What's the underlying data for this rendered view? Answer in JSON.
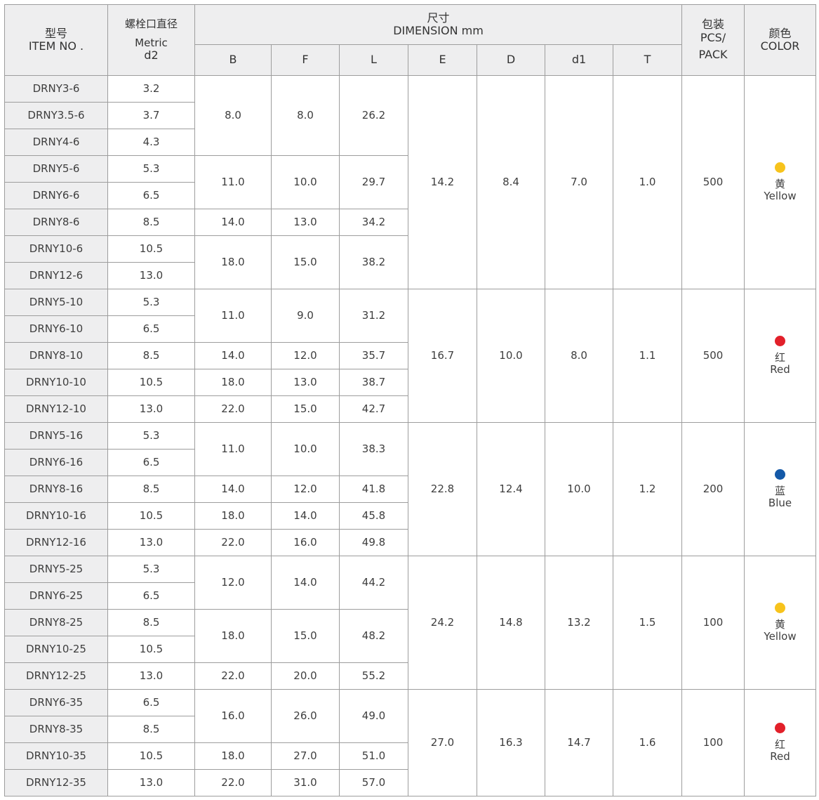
{
  "header": {
    "item_cn": "型号",
    "item_en": "ITEM NO .",
    "bolt_cn": "螺栓口直径",
    "bolt_en": "Metric",
    "bolt_sym": "d2",
    "dim_cn": "尺寸",
    "dim_en": "DIMENSION mm",
    "pack_cn": "包装",
    "pack_en1": "PCS/",
    "pack_en2": "PACK",
    "color_cn": "颜色",
    "color_en": "COLOR",
    "cols": [
      "B",
      "F",
      "L",
      "E",
      "D",
      "d1",
      "T"
    ]
  },
  "rows": [
    [
      "DRNY3-6",
      "3.2"
    ],
    [
      "DRNY3.5-6",
      "3.7"
    ],
    [
      "DRNY4-6",
      "4.3"
    ],
    [
      "DRNY5-6",
      "5.3"
    ],
    [
      "DRNY6-6",
      "6.5"
    ],
    [
      "DRNY8-6",
      "8.5"
    ],
    [
      "DRNY10-6",
      "10.5"
    ],
    [
      "DRNY12-6",
      "13.0"
    ],
    [
      "DRNY5-10",
      "5.3"
    ],
    [
      "DRNY6-10",
      "6.5"
    ],
    [
      "DRNY8-10",
      "8.5"
    ],
    [
      "DRNY10-10",
      "10.5"
    ],
    [
      "DRNY12-10",
      "13.0"
    ],
    [
      "DRNY5-16",
      "5.3"
    ],
    [
      "DRNY6-16",
      "6.5"
    ],
    [
      "DRNY8-16",
      "8.5"
    ],
    [
      "DRNY10-16",
      "10.5"
    ],
    [
      "DRNY12-16",
      "13.0"
    ],
    [
      "DRNY5-25",
      "5.3"
    ],
    [
      "DRNY6-25",
      "6.5"
    ],
    [
      "DRNY8-25",
      "8.5"
    ],
    [
      "DRNY10-25",
      "10.5"
    ],
    [
      "DRNY12-25",
      "13.0"
    ],
    [
      "DRNY6-35",
      "6.5"
    ],
    [
      "DRNY8-35",
      "8.5"
    ],
    [
      "DRNY10-35",
      "10.5"
    ],
    [
      "DRNY12-35",
      "13.0"
    ]
  ],
  "bfl": [
    [
      "8.0",
      "8.0",
      "26.2"
    ],
    [
      "11.0",
      "10.0",
      "29.7"
    ],
    [
      "14.0",
      "13.0",
      "34.2"
    ],
    [
      "18.0",
      "15.0",
      "38.2"
    ],
    [
      "11.0",
      "9.0",
      "31.2"
    ],
    [
      "14.0",
      "12.0",
      "35.7"
    ],
    [
      "18.0",
      "13.0",
      "38.7"
    ],
    [
      "22.0",
      "15.0",
      "42.7"
    ],
    [
      "11.0",
      "10.0",
      "38.3"
    ],
    [
      "14.0",
      "12.0",
      "41.8"
    ],
    [
      "18.0",
      "14.0",
      "45.8"
    ],
    [
      "22.0",
      "16.0",
      "49.8"
    ],
    [
      "12.0",
      "14.0",
      "44.2"
    ],
    [
      "18.0",
      "15.0",
      "48.2"
    ],
    [
      "22.0",
      "20.0",
      "55.2"
    ],
    [
      "16.0",
      "26.0",
      "49.0"
    ],
    [
      "18.0",
      "27.0",
      "51.0"
    ],
    [
      "22.0",
      "31.0",
      "57.0"
    ]
  ],
  "groups": [
    {
      "E": "14.2",
      "D": "8.4",
      "d1": "7.0",
      "T": "1.0",
      "pack": "500",
      "color_cn": "黄",
      "color_en": "Yellow",
      "dot": "#f7c31c"
    },
    {
      "E": "16.7",
      "D": "10.0",
      "d1": "8.0",
      "T": "1.1",
      "pack": "500",
      "color_cn": "红",
      "color_en": "Red",
      "dot": "#e2202a"
    },
    {
      "E": "22.8",
      "D": "12.4",
      "d1": "10.0",
      "T": "1.2",
      "pack": "200",
      "color_cn": "蓝",
      "color_en": "Blue",
      "dot": "#1459a8"
    },
    {
      "E": "24.2",
      "D": "14.8",
      "d1": "13.2",
      "T": "1.5",
      "pack": "100",
      "color_cn": "黄",
      "color_en": "Yellow",
      "dot": "#f7c31c"
    },
    {
      "E": "27.0",
      "D": "16.3",
      "d1": "14.7",
      "T": "1.6",
      "pack": "100",
      "color_cn": "红",
      "color_en": "Red",
      "dot": "#e2202a"
    }
  ]
}
